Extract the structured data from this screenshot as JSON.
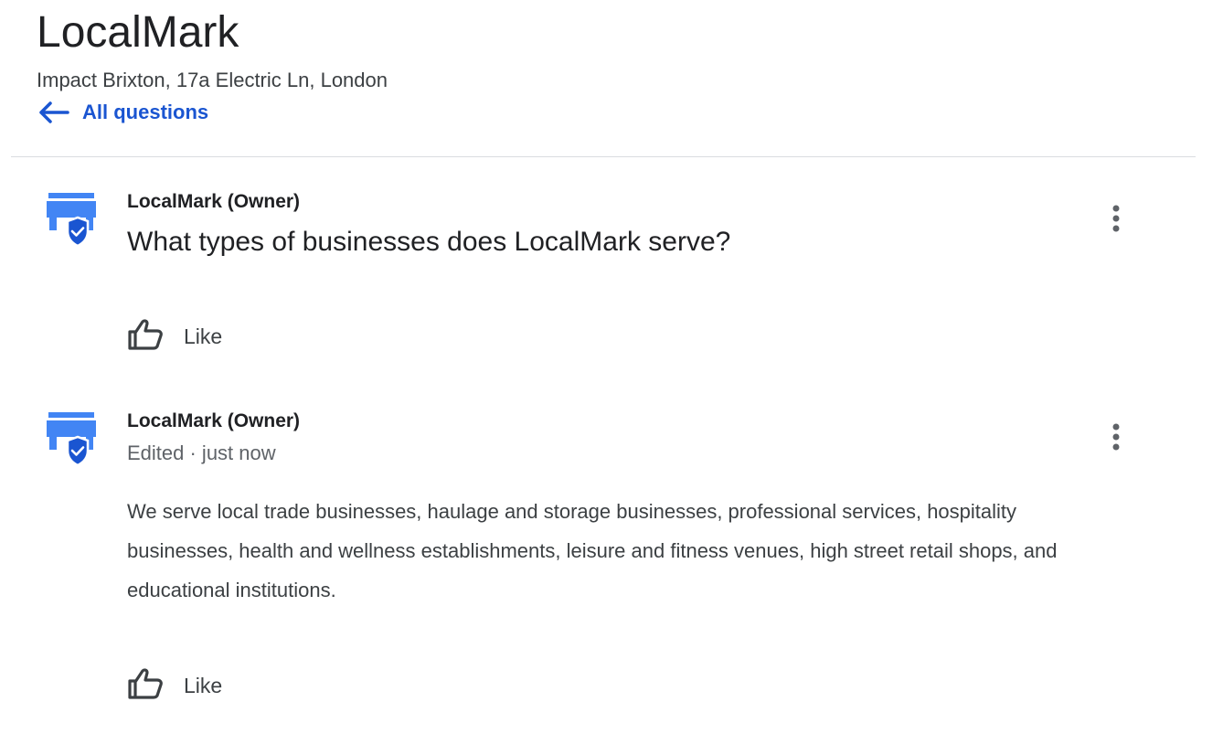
{
  "header": {
    "title": "LocalMark",
    "address": "Impact Brixton, 17a Electric Ln, London",
    "back_label": "All questions"
  },
  "question": {
    "author": "LocalMark (Owner)",
    "text": "What types of businesses does LocalMark serve?",
    "like_label": "Like"
  },
  "answer": {
    "author": "LocalMark (Owner)",
    "meta": "Edited · just now",
    "text": "We serve local trade businesses, haulage and storage businesses, professional services, hospitality businesses, health and wellness establishments, leisure and fitness venues, high street retail shops, and educational institutions.",
    "like_label": "Like"
  },
  "icons": {
    "avatar": "verified-storefront-icon",
    "back": "arrow-left-icon",
    "more": "more-vert-icon",
    "like": "thumb-up-icon"
  },
  "colors": {
    "accent": "#1a55d1",
    "icon_blue": "#4285f4",
    "shield_blue": "#1a55d1"
  }
}
